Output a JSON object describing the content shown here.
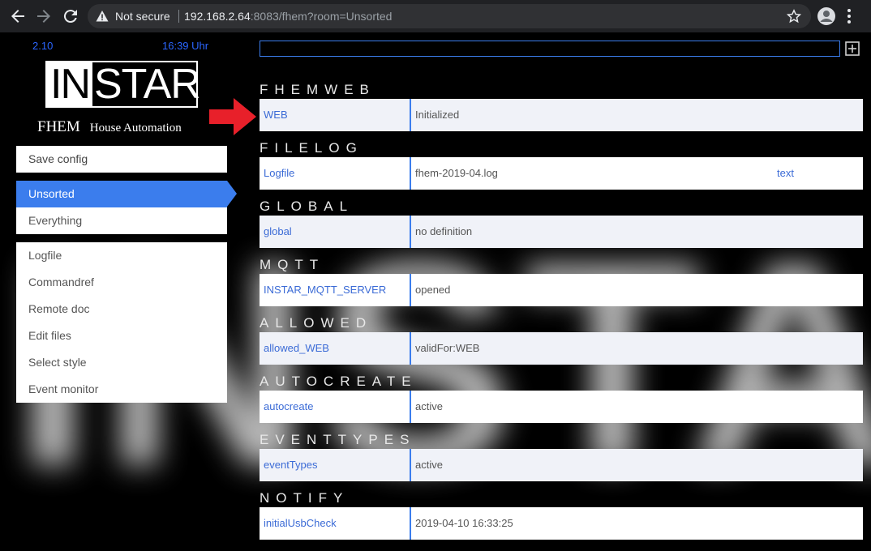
{
  "browser": {
    "not_secure": "Not secure",
    "url_host": "192.168.2.64",
    "url_rest": ":8083/fhem?room=Unsorted"
  },
  "header": {
    "version": "2.10",
    "time": "16:39 Uhr",
    "logo_in": "IN",
    "logo_star": "STAR",
    "subtitle_fhem": "FHEM",
    "subtitle_house": "House Automation"
  },
  "menu": {
    "save_config": "Save config",
    "rooms": [
      "Unsorted",
      "Everything"
    ],
    "links": [
      "Logfile",
      "Commandref",
      "Remote doc",
      "Edit files",
      "Select style",
      "Event monitor"
    ]
  },
  "sections": [
    {
      "title": "FHEMWEB",
      "name": "WEB",
      "state": "Initialized",
      "extra": ""
    },
    {
      "title": "FILELOG",
      "name": "Logfile",
      "state": "fhem-2019-04.log",
      "extra": "text"
    },
    {
      "title": "GLOBAL",
      "name": "global",
      "state": "no definition",
      "extra": ""
    },
    {
      "title": "MQTT",
      "name": "INSTAR_MQTT_SERVER",
      "state": "opened",
      "extra": ""
    },
    {
      "title": "ALLOWED",
      "name": "allowed_WEB",
      "state": "validFor:WEB",
      "extra": ""
    },
    {
      "title": "AUTOCREATE",
      "name": "autocreate",
      "state": "active",
      "extra": ""
    },
    {
      "title": "EVENTTYPES",
      "name": "eventTypes",
      "state": "active",
      "extra": ""
    },
    {
      "title": "NOTIFY",
      "name": "initialUsbCheck",
      "state": "2019-04-10 16:33:25",
      "extra": ""
    }
  ],
  "watermark": "INSTAR",
  "colors": {
    "accent": "#3b7ded",
    "link": "#3b6bd6",
    "arrow": "#e8202a"
  }
}
